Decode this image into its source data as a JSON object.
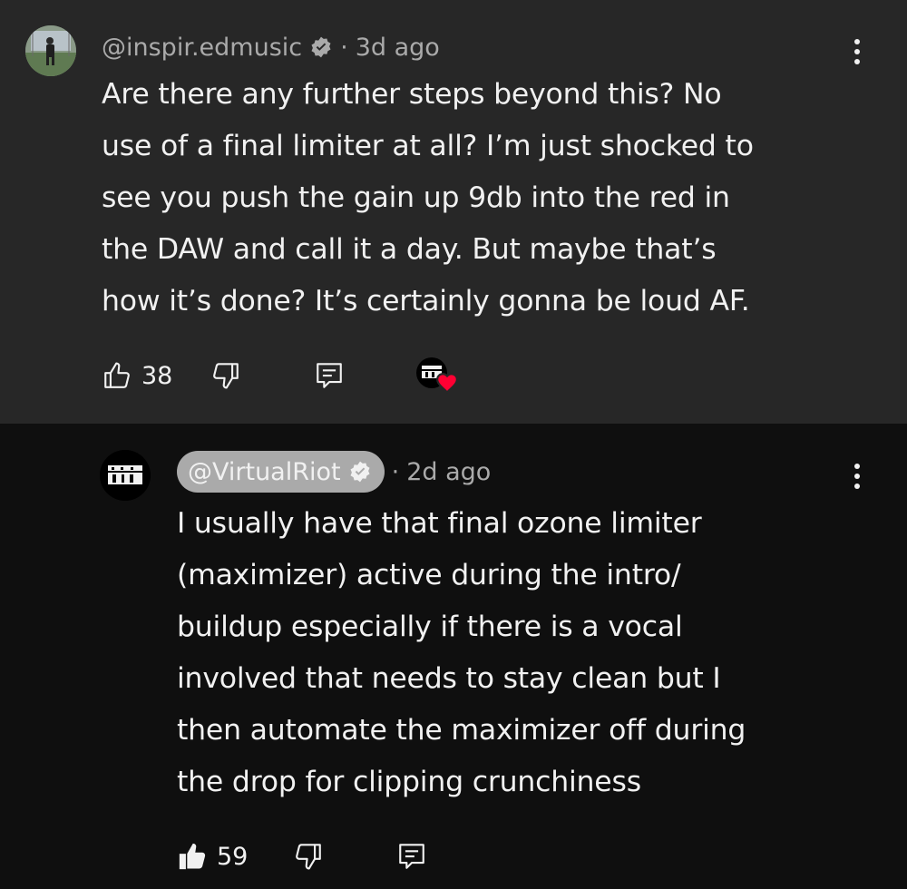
{
  "comments": [
    {
      "handle": "@inspir.edmusic",
      "time": "3d ago",
      "text": "Are there any further steps beyond this? No\nuse of a final limiter at all? I’m just shocked to\nsee you push the gain up 9db into the red in\nthe DAW and call it a day. But maybe that’s\nhow it’s done? It’s certainly gonna be loud AF.",
      "likes": "38"
    },
    {
      "handle": "@VirtualRiot",
      "time": "2d ago",
      "text": "I usually have that final ozone limiter\n(maximizer) active during the intro/\nbuildup especially if there is a vocal\ninvolved that needs to stay clean but I\nthen automate the maximizer off during\nthe drop for clipping crunchiness",
      "likes": "59"
    }
  ],
  "separator": "·",
  "icons": [
    "verified-icon",
    "like-icon",
    "dislike-icon",
    "reply-icon",
    "more-icon",
    "creator-heart-icon"
  ],
  "colors": {
    "top_bg": "#272727",
    "reply_bg": "#0f0f0f",
    "text": "#f1f1f1",
    "muted": "#aaaaaa",
    "heart": "#ff0033"
  }
}
